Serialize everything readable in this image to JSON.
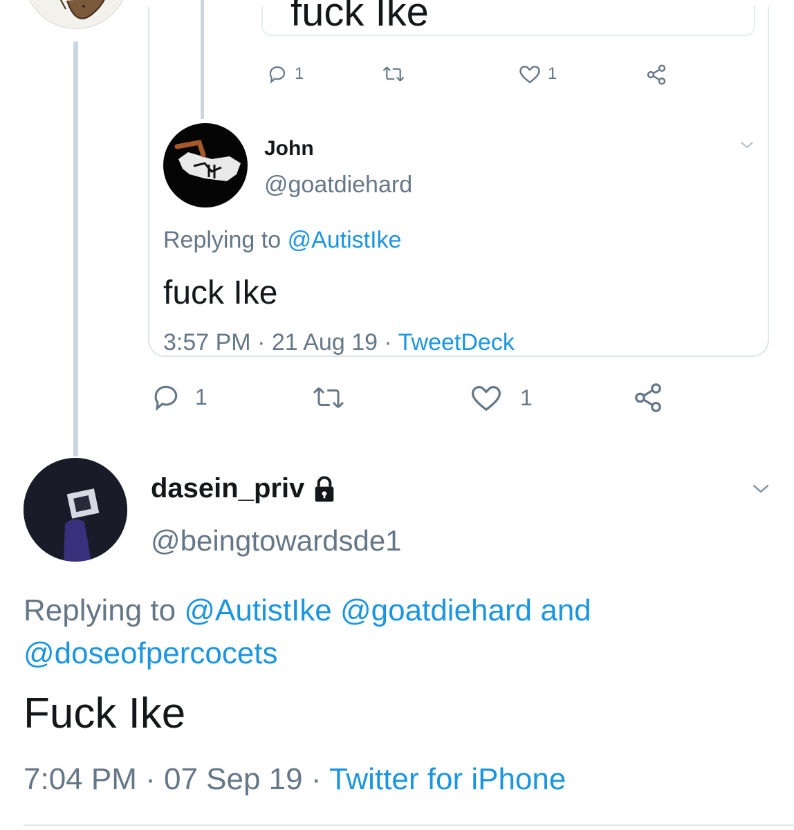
{
  "inner": {
    "quoted_text": "fuck Ike",
    "actions": {
      "replies": "1",
      "likes": "1"
    }
  },
  "card_tweet": {
    "name": "John",
    "handle": "@goatdiehard",
    "replying_prefix": "Replying to",
    "replying_handle": "@AutistIke",
    "text": "fuck Ike",
    "time": "3:57 PM",
    "date": "21 Aug 19",
    "source": "TweetDeck",
    "sep": "·"
  },
  "mid_actions": {
    "replies": "1",
    "likes": "1"
  },
  "main_tweet": {
    "name": "dasein_priv",
    "handle": "@beingtowardsde1",
    "replying_prefix": "Replying to",
    "replying_handles": [
      "@AutistIke",
      "@goatdiehard"
    ],
    "replying_and": "and",
    "replying_handle_last": "@doseofpercocets",
    "text": "Fuck Ike",
    "time": "7:04 PM",
    "date": "07 Sep 19",
    "source": "Twitter for iPhone",
    "sep": "·"
  },
  "colors": {
    "link": "#1b95e0",
    "muted": "#657786",
    "thread_line": "#cbd5de",
    "text": "#14171a"
  },
  "icons": [
    "reply-icon",
    "retweet-icon",
    "like-icon",
    "share-icon",
    "lock-icon",
    "chevron-down-icon"
  ]
}
